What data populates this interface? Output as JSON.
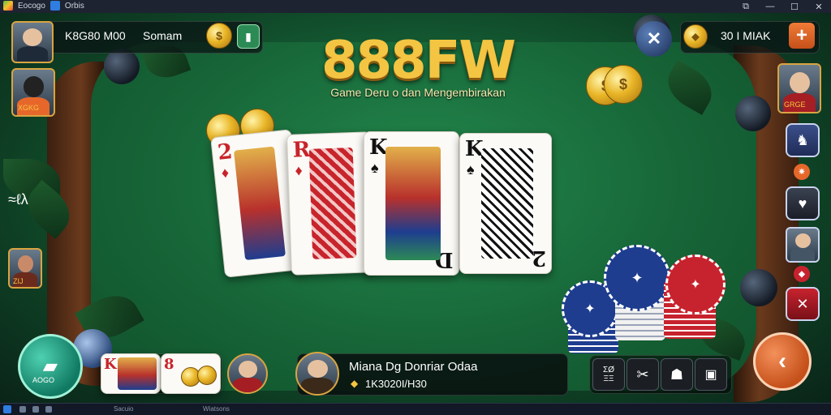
{
  "window": {
    "title_left": "Eocogo",
    "title_tab": "Orbis",
    "controls": [
      "restore",
      "minimize",
      "maximize",
      "close"
    ]
  },
  "top_left_panel": {
    "player_id": "K8G80 M00",
    "player_name": "Somam",
    "coin_icon": "coin-icon",
    "wallet_icon": "wallet-icon"
  },
  "left_player_badge": {
    "label": "XGKG"
  },
  "left_side_icon_text": "≈ℓλ",
  "left_small_avatar_label": "ZIJ",
  "brand": {
    "title": "888FW",
    "tagline": "Game Deru o dan Mengembirakan"
  },
  "top_right_panel": {
    "close_label": "✕",
    "amount": "30 I MIAK",
    "plus_label": "+"
  },
  "right_player_badge": {
    "label": "GRGE"
  },
  "cards": [
    {
      "rank": "2",
      "suit": "♦",
      "color": "#c8242b"
    },
    {
      "rank": "R",
      "suit": "♦",
      "color": "#c8242b"
    },
    {
      "rank": "K",
      "suit": "♠",
      "color": "#111111",
      "bottom_rank": "D"
    },
    {
      "rank": "K",
      "suit": "♠",
      "color": "#111111",
      "bottom_rank": "2"
    }
  ],
  "bottom_left_button": {
    "label": "AOGO"
  },
  "hand_cards": [
    {
      "rank": "K",
      "color": "#c8242b"
    },
    {
      "rank": "8",
      "color": "#c8242b"
    }
  ],
  "info_panel": {
    "line1": "Miana Dg Donriar Odaa",
    "line2": "1K3020I/H30"
  },
  "bottom_right_buttons": [
    {
      "label": "ΣØ\nΞΞ",
      "icon": "text-icon"
    },
    {
      "icon": "tools-icon"
    },
    {
      "icon": "bell-icon"
    },
    {
      "icon": "gamepad-icon"
    }
  ],
  "taskbar": {
    "items": [
      "Sacuio",
      "Wiatsons"
    ]
  },
  "colors": {
    "felt": "#1b7a42",
    "gold": "#f4c542",
    "rail": "#6b3a1c",
    "accent_orange": "#e7672a",
    "chip_blue": "#1e3d8f",
    "chip_red": "#c7232e"
  }
}
